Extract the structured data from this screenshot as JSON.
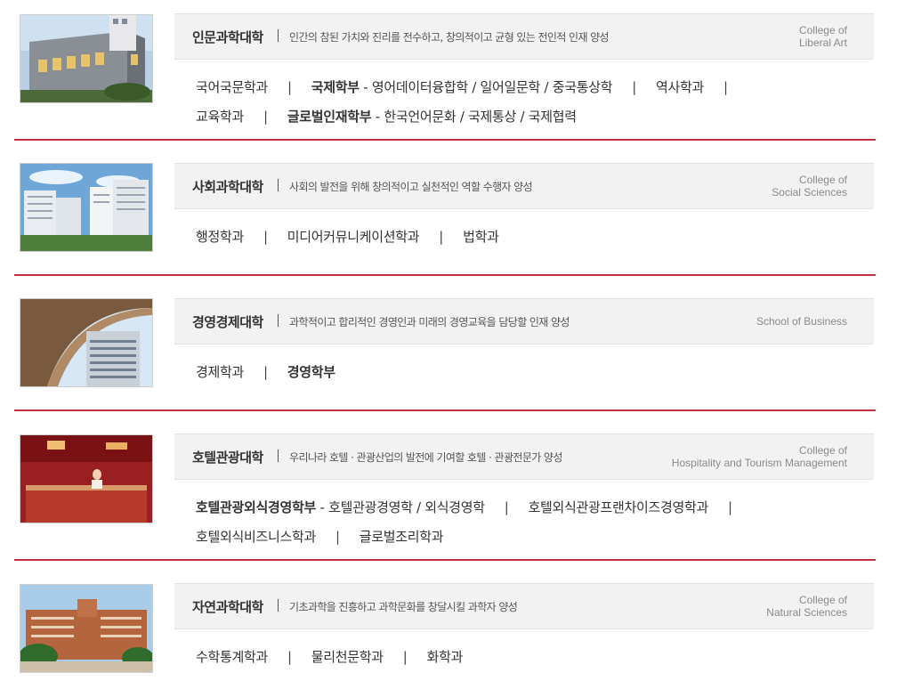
{
  "colleges": [
    {
      "ko": "인문과학대학",
      "motto": "인간의 참된 가치와 진리를 전수하고, 창의적이고 균형 있는 전인적 인재 양성",
      "en1": "College of",
      "en2": "Liberal Art",
      "image": "humanities-building-photo",
      "line1": {
        "a": "국어국문학과",
        "b_bold": "국제학부",
        "b_sub": " - 영어데이터융합학 / 일어일문학 / 중국통상학",
        "c": "역사학과"
      },
      "line2": {
        "a": "교육학과",
        "b_bold": "글로벌인재학부",
        "b_sub": " - 한국언어문화 / 국제통상 / 국제협력"
      }
    },
    {
      "ko": "사회과학대학",
      "motto": "사회의 발전을 위해 창의적이고 실천적인 역할 수행자 양성",
      "en1": "College of",
      "en2": "Social Sciences",
      "image": "social-sciences-building-photo",
      "line1": {
        "a": "행정학과",
        "b": "미디어커뮤니케이션학과",
        "c": "법학과"
      }
    },
    {
      "ko": "경영경제대학",
      "motto": "과학적이고 합리적인 경영인과 미래의 경영교육을 담당할 인재 양성",
      "en1": "School of Business",
      "image": "business-building-photo",
      "line1": {
        "a": "경제학과",
        "b_bold": "경영학부"
      }
    },
    {
      "ko": "호텔관광대학",
      "motto": "우리나라 호텔 · 관광산업의 발전에 기여할 호텔 · 관광전문가 양성",
      "en1": "College of",
      "en2": "Hospitality and Tourism Management",
      "image": "hotel-lobby-photo",
      "line1": {
        "a_bold": "호텔관광외식경영학부",
        "a_sub": " - 호텔관광경영학 / 외식경영학",
        "b": "호텔외식관광프랜차이즈경영학과"
      },
      "line2": {
        "a": "호텔외식비즈니스학과",
        "b": "글로벌조리학과"
      }
    },
    {
      "ko": "자연과학대학",
      "motto": "기초과학을 진흥하고 과학문화를 창달시킬 과학자 양성",
      "en1": "College of",
      "en2": "Natural Sciences",
      "image": "natural-sciences-building-photo",
      "line1": {
        "a": "수학통계학과",
        "b": "물리천문학과",
        "c": "화학과"
      }
    }
  ],
  "divider_char": "|",
  "accent_color": "#c0313f"
}
